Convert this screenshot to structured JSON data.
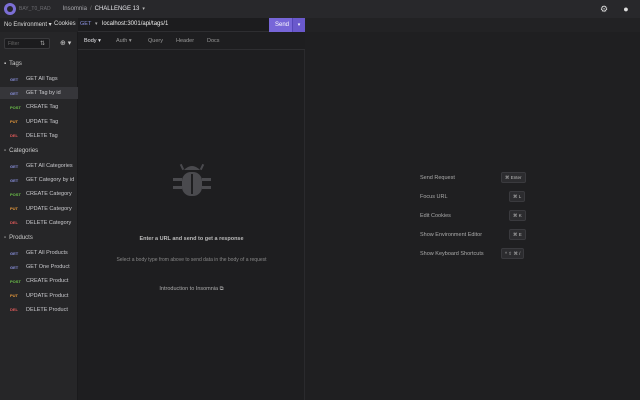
{
  "app": {
    "brand_sub": "BAY_T0_RAD",
    "breadcrumb_root": "Insomnia",
    "breadcrumb_sep": "/",
    "breadcrumb_current": "CHALLENGE 13",
    "caret": "▾"
  },
  "toolbar": {
    "environment": "No Environment ▾",
    "cookies": "Cookies",
    "method": "GET",
    "url": "localhost:3001/api/tags/1",
    "send_label": "Send",
    "send_caret": "▾"
  },
  "sidebar": {
    "filter_placeholder": "Filter",
    "folders": [
      {
        "name": "Tags",
        "requests": [
          {
            "method": "GET",
            "name": "GET All Tags"
          },
          {
            "method": "GET",
            "name": "GET Tag by id",
            "selected": true
          },
          {
            "method": "POST",
            "name": "CREATE Tag"
          },
          {
            "method": "PUT",
            "name": "UPDATE Tag"
          },
          {
            "method": "DEL",
            "name": "DELETE Tag"
          }
        ]
      },
      {
        "name": "Categories",
        "requests": [
          {
            "method": "GET",
            "name": "GET All Categories"
          },
          {
            "method": "GET",
            "name": "GET Category by id"
          },
          {
            "method": "POST",
            "name": "CREATE Category"
          },
          {
            "method": "PUT",
            "name": "UPDATE Category"
          },
          {
            "method": "DEL",
            "name": "DELETE Category"
          }
        ]
      },
      {
        "name": "Products",
        "requests": [
          {
            "method": "GET",
            "name": "GET All Products"
          },
          {
            "method": "GET",
            "name": "GET One Product"
          },
          {
            "method": "POST",
            "name": "CREATE Product"
          },
          {
            "method": "PUT",
            "name": "UPDATE Product"
          },
          {
            "method": "DEL",
            "name": "DELETE Product"
          }
        ]
      }
    ]
  },
  "request_tabs": [
    "Body ▾",
    "Auth ▾",
    "Query",
    "Header",
    "Docs"
  ],
  "empty_state": {
    "title": "Enter a URL and send to get a response",
    "subtitle": "Select a body type from above to send data in the body of a request",
    "link": "Introduction to Insomnia"
  },
  "shortcuts": [
    {
      "label": "Send Request",
      "key": "⌘ Enter"
    },
    {
      "label": "Focus URL",
      "key": "⌘ L"
    },
    {
      "label": "Edit Cookies",
      "key": "⌘ K"
    },
    {
      "label": "Show Environment Editor",
      "key": "⌘ E"
    },
    {
      "label": "Show Keyboard Shortcuts",
      "key": "^ ⇧ ⌘ /"
    }
  ],
  "colors": {
    "accent": "#7766d8",
    "get": "#8b92e0",
    "post": "#6cc04a",
    "put": "#e89a3c",
    "delete": "#e05a5a"
  }
}
